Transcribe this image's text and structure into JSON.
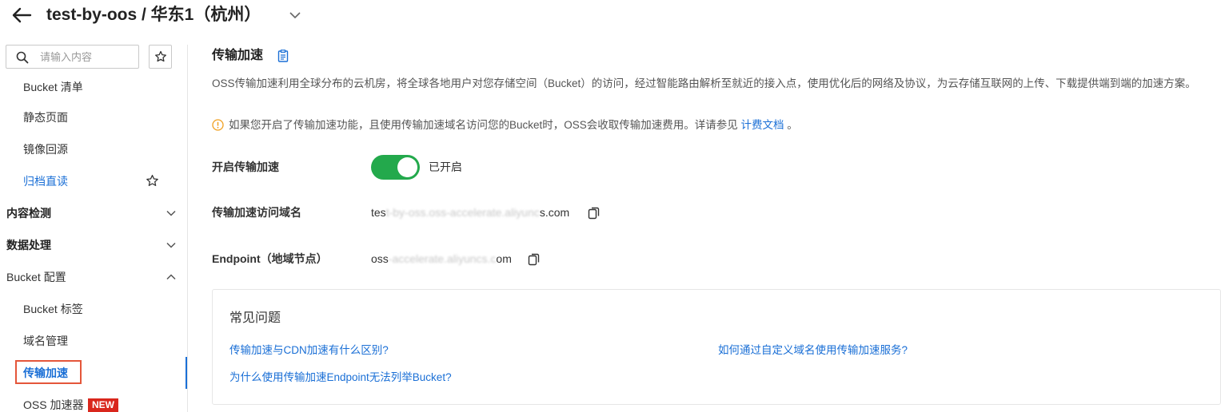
{
  "header": {
    "title": "test-by-oos / 华东1（杭州）"
  },
  "sidebar": {
    "search_placeholder": "请输入内容",
    "items": [
      {
        "label": "Bucket 清单"
      },
      {
        "label": "静态页面"
      },
      {
        "label": "镜像回源"
      },
      {
        "label": "归档直读"
      },
      {
        "label": "内容检测"
      },
      {
        "label": "数据处理"
      },
      {
        "label": "Bucket 配置"
      },
      {
        "label": "Bucket 标签"
      },
      {
        "label": "域名管理"
      },
      {
        "label": "传输加速"
      },
      {
        "label": "OSS 加速器",
        "badge": "NEW"
      }
    ]
  },
  "main": {
    "title": "传输加速",
    "description": "OSS传输加速利用全球分布的云机房，将全球各地用户对您存储空间（Bucket）的访问，经过智能路由解析至就近的接入点，使用优化后的网络及协议，为云存储互联网的上传、下载提供端到端的加速方案。",
    "notice_prefix": "如果您开启了传输加速功能，且使用传输加速域名访问您的Bucket时，OSS会收取传输加速费用。详请参见 ",
    "notice_link": "计费文档",
    "notice_suffix": " 。",
    "enable_label": "开启传输加速",
    "enable_status": "已开启",
    "enabled": true,
    "domain_label": "传输加速访问域名",
    "domain_head": "tes",
    "domain_blur": "t-by-oss.oss-accelerate.aliyunc",
    "domain_tail": "s.com",
    "endpoint_label": "Endpoint（地域节点）",
    "endpoint_head": "oss",
    "endpoint_blur": "-accelerate.aliyuncs.c",
    "endpoint_tail": "om",
    "faq": {
      "title": "常见问题",
      "links": [
        "传输加速与CDN加速有什么区别?",
        "如何通过自定义域名使用传输加速服务?",
        "为什么使用传输加速Endpoint无法列举Bucket?"
      ]
    }
  }
}
